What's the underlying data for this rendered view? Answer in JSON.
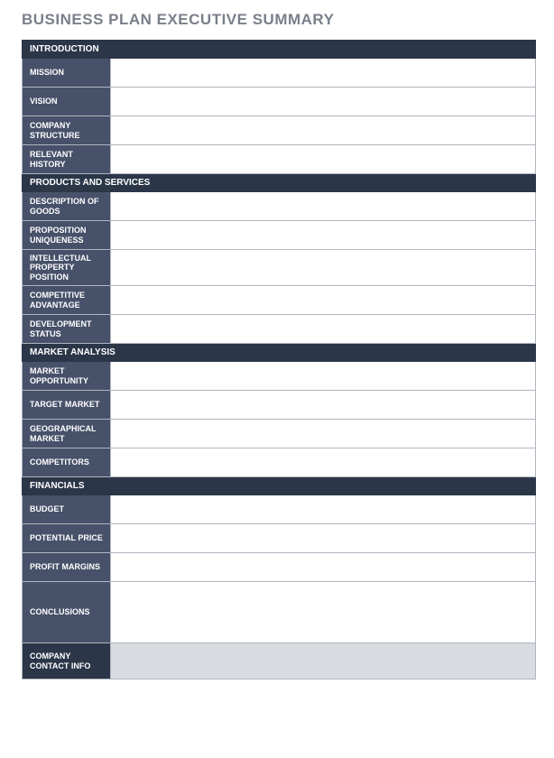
{
  "title": "BUSINESS PLAN EXECUTIVE SUMMARY",
  "sections": {
    "introduction": {
      "header": "INTRODUCTION",
      "rows": {
        "mission": {
          "label": "MISSION",
          "value": ""
        },
        "vision": {
          "label": "VISION",
          "value": ""
        },
        "company_structure": {
          "label": "COMPANY STRUCTURE",
          "value": ""
        },
        "relevant_history": {
          "label": "RELEVANT HISTORY",
          "value": ""
        }
      }
    },
    "products_services": {
      "header": "PRODUCTS AND SERVICES",
      "rows": {
        "description_of_goods": {
          "label": "DESCRIPTION OF GOODS",
          "value": ""
        },
        "proposition_uniqueness": {
          "label": "PROPOSITION UNIQUENESS",
          "value": ""
        },
        "ip_position": {
          "label": "INTELLECTUAL PROPERTY POSITION",
          "value": ""
        },
        "competitive_advantage": {
          "label": "COMPETITIVE ADVANTAGE",
          "value": ""
        },
        "development_status": {
          "label": "DEVELOPMENT STATUS",
          "value": ""
        }
      }
    },
    "market_analysis": {
      "header": "MARKET ANALYSIS",
      "rows": {
        "market_opportunity": {
          "label": "MARKET OPPORTUNITY",
          "value": ""
        },
        "target_market": {
          "label": "TARGET MARKET",
          "value": ""
        },
        "geographical_market": {
          "label": "GEOGRAPHICAL MARKET",
          "value": ""
        },
        "competitors": {
          "label": "COMPETITORS",
          "value": ""
        }
      }
    },
    "financials": {
      "header": "FINANCIALS",
      "rows": {
        "budget": {
          "label": "BUDGET",
          "value": ""
        },
        "potential_price": {
          "label": "POTENTIAL PRICE",
          "value": ""
        },
        "profit_margins": {
          "label": "PROFIT MARGINS",
          "value": ""
        },
        "conclusions": {
          "label": "CONCLUSIONS",
          "value": ""
        }
      }
    },
    "contact": {
      "rows": {
        "company_contact_info": {
          "label": "COMPANY CONTACT INFO",
          "value": ""
        }
      }
    }
  }
}
